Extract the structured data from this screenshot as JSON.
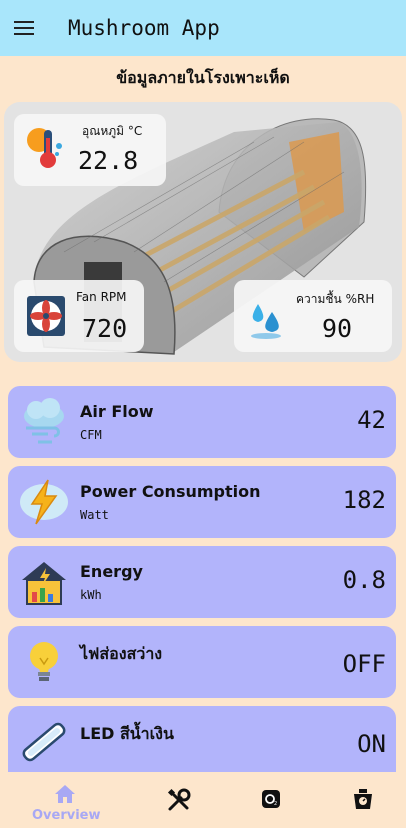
{
  "app": {
    "title": "Mushroom App"
  },
  "section": {
    "title": "ข้อมูลภายในโรงเพาะเห็ด"
  },
  "sensors": {
    "temperature": {
      "label": "อุณหภูมิ °C",
      "value": "22.8",
      "icon": "thermometer-icon"
    },
    "fan": {
      "label": "Fan RPM",
      "value": "720",
      "icon": "fan-icon"
    },
    "humidity": {
      "label": "ความชื้น %RH",
      "value": "90",
      "icon": "water-drops-icon"
    }
  },
  "rows": [
    {
      "title": "Air Flow",
      "unit": "CFM",
      "value": "42",
      "icon": "wind-cloud-icon"
    },
    {
      "title": "Power Consumption",
      "unit": "Watt",
      "value": "182",
      "icon": "lightning-icon"
    },
    {
      "title": "Energy",
      "unit": "kWh",
      "value": "0.8",
      "icon": "solar-house-icon"
    },
    {
      "title": "ไฟส่องสว่าง",
      "unit": "",
      "value": "OFF",
      "icon": "lightbulb-icon"
    },
    {
      "title": "LED สีน้ำเงิน",
      "unit": "",
      "value": "ON",
      "icon": "led-tube-icon"
    }
  ],
  "nav": {
    "items": [
      {
        "label": "Overview",
        "icon": "home-icon",
        "active": true
      },
      {
        "label": "",
        "icon": "tools-icon"
      },
      {
        "label": "",
        "icon": "o2-icon"
      },
      {
        "label": "",
        "icon": "scale-icon"
      }
    ]
  },
  "colors": {
    "appbar": "#a9e6fb",
    "background": "#fde6cc",
    "card": "#b2b4fb",
    "nav_active": "#a8a8f4"
  }
}
